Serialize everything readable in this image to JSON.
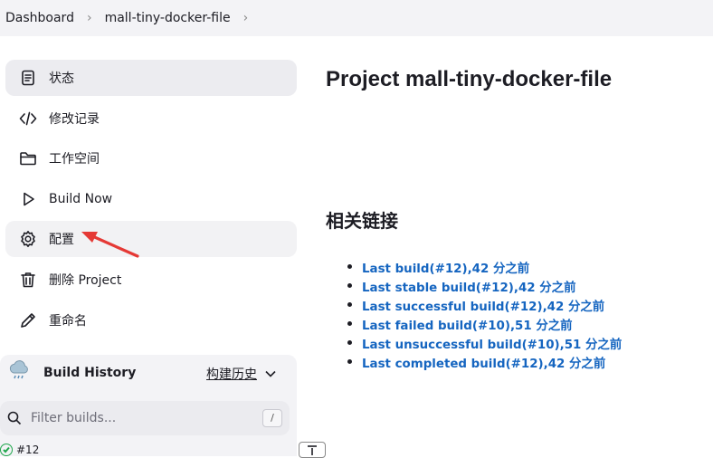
{
  "breadcrumb": {
    "items": [
      "Dashboard",
      "mall-tiny-docker-file"
    ],
    "separator": "›"
  },
  "sidebar": {
    "tasks": [
      {
        "label": "状态",
        "icon": "document-icon"
      },
      {
        "label": "修改记录",
        "icon": "code-icon"
      },
      {
        "label": "工作空间",
        "icon": "folder-icon"
      },
      {
        "label": "Build Now",
        "icon": "play-icon"
      },
      {
        "label": "配置",
        "icon": "gear-icon"
      },
      {
        "label": "删除 Project",
        "icon": "trash-icon"
      },
      {
        "label": "重命名",
        "icon": "pencil-icon"
      }
    ],
    "build_history": {
      "title": "Build History",
      "trend_label": "构建历史",
      "filter_placeholder": "Filter builds...",
      "filter_shortcut": "/",
      "first_build": "#12"
    }
  },
  "main": {
    "title": "Project mall-tiny-docker-file",
    "related_title": "相关链接",
    "links": [
      "Last build(#12),42 分之前",
      "Last stable build(#12),42 分之前",
      "Last successful build(#12),42 分之前",
      "Last failed build(#10),51 分之前",
      "Last unsuccessful build(#10),51 分之前",
      "Last completed build(#12),42 分之前"
    ]
  },
  "colors": {
    "link": "#1565c0",
    "success": "#1ea64b",
    "annotation_arrow": "#e53935",
    "panel_bg": "#f3f3f6"
  }
}
